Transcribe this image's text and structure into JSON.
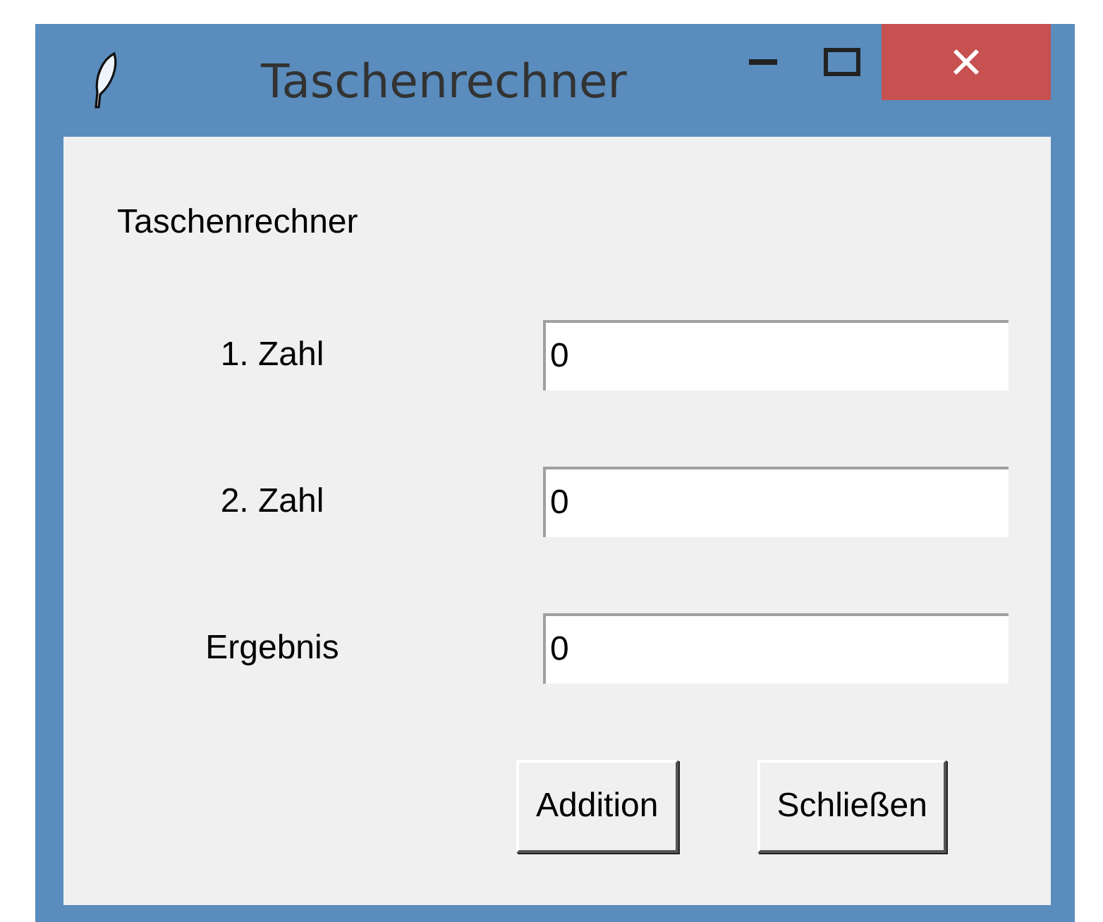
{
  "window": {
    "title": "Taschenrechner"
  },
  "heading": "Taschenrechner",
  "fields": [
    {
      "label": "1. Zahl",
      "value": "0"
    },
    {
      "label": "2. Zahl",
      "value": "0"
    },
    {
      "label": "Ergebnis",
      "value": "0"
    }
  ],
  "buttons": [
    "Addition",
    "Schließen"
  ]
}
